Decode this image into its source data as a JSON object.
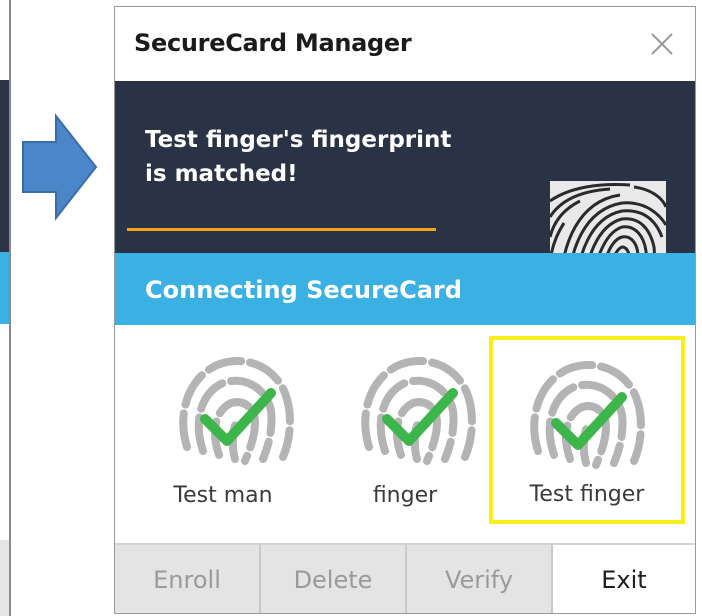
{
  "dialog": {
    "title": "SecureCard Manager",
    "close_icon": "close-icon"
  },
  "banner": {
    "line1": "Test finger's fingerprint",
    "line2": "is matched!",
    "image": "fingerprint-thumbnail"
  },
  "status": {
    "text": "Connecting SecureCard"
  },
  "users": [
    {
      "name": "Test man",
      "icon": "fingerprint-check-icon",
      "selected": false
    },
    {
      "name": "finger",
      "icon": "fingerprint-check-icon",
      "selected": false
    },
    {
      "name": "Test finger",
      "icon": "fingerprint-check-icon",
      "selected": true
    }
  ],
  "buttons": {
    "enroll": "Enroll",
    "delete": "Delete",
    "verify": "Verify",
    "exit": "Exit"
  },
  "colors": {
    "banner_bg": "#2a3345",
    "status_bg": "#3bb1e3",
    "underline": "#f5a31a",
    "selection_border": "#f5ef1b",
    "check_green": "#3cb54a",
    "arrow_blue": "#4a86c8"
  }
}
